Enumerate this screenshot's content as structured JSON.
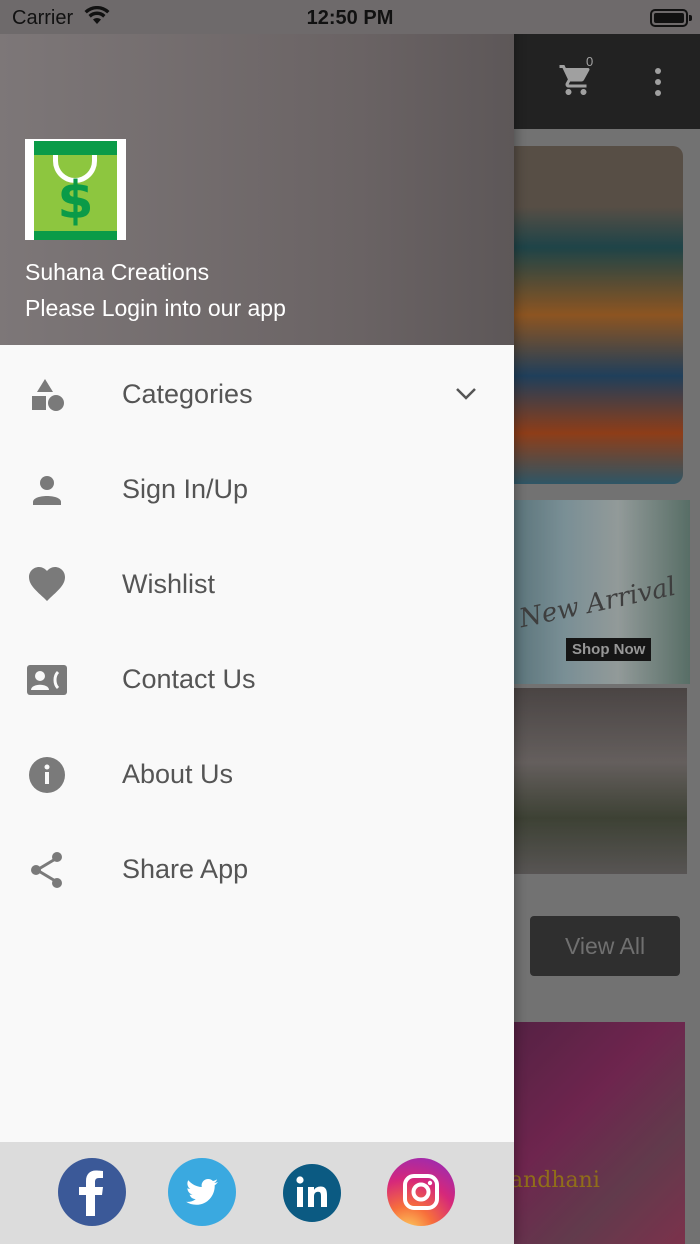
{
  "status_bar": {
    "carrier": "Carrier",
    "time": "12:50 PM"
  },
  "background": {
    "cart_count": "0",
    "banner_text": "New Arrival",
    "shop_now": "Shop Now",
    "view_all": "View All",
    "bandhani_text": "andhani"
  },
  "drawer": {
    "title": "Suhana Creations",
    "subtitle": "Please Login into our app",
    "items": [
      {
        "label": "Categories",
        "icon": "categories-icon"
      },
      {
        "label": "Sign In/Up",
        "icon": "person-icon"
      },
      {
        "label": "Wishlist",
        "icon": "heart-icon"
      },
      {
        "label": "Contact Us",
        "icon": "contact-card-icon"
      },
      {
        "label": "About Us",
        "icon": "info-icon"
      },
      {
        "label": "Share App",
        "icon": "share-icon"
      }
    ],
    "social": [
      "facebook-icon",
      "twitter-icon",
      "linkedin-icon",
      "instagram-icon"
    ]
  },
  "colors": {
    "icon_gray": "#7a7a7a",
    "text_gray": "#555555",
    "header_gray": "#6e6869"
  }
}
